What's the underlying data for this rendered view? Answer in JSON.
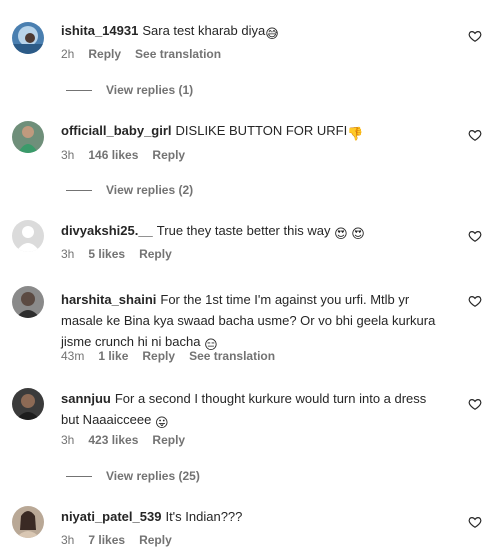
{
  "comments": [
    {
      "username": "ishita_14931",
      "text": "Sara test kharab diya",
      "emoji": "😅",
      "time": "2h",
      "likes": "",
      "reply": "Reply",
      "translation": "See translation",
      "view_replies": "View replies (1)"
    },
    {
      "username": "officiall_baby_girl",
      "text": "DISLIKE BUTTON FOR URFI",
      "emoji": "👎",
      "time": "3h",
      "likes": "146 likes",
      "reply": "Reply",
      "translation": "",
      "view_replies": "View replies (2)"
    },
    {
      "username": "divyakshi25.__",
      "text": "True they taste better this way",
      "emoji": "😍 😍",
      "time": "3h",
      "likes": "5 likes",
      "reply": "Reply",
      "translation": "",
      "view_replies": ""
    },
    {
      "username": "harshita_shaini",
      "text": "For the 1st time I'm against you urfi. Mtlb yr masale ke Bina kya swaad bacha usme? Or vo bhi geela kurkura jisme crunch hi ni bacha",
      "emoji": "😑",
      "time": "43m",
      "likes": "1 like",
      "reply": "Reply",
      "translation": "See translation",
      "view_replies": ""
    },
    {
      "username": "sannjuu",
      "text": "For a second I thought kurkure would turn into a dress but Naaaicceee",
      "emoji": "😛",
      "time": "3h",
      "likes": "423 likes",
      "reply": "Reply",
      "translation": "",
      "view_replies": "View replies (25)"
    },
    {
      "username": "niyati_patel_539",
      "text": "It's Indian???",
      "emoji": "",
      "time": "3h",
      "likes": "7 likes",
      "reply": "Reply",
      "translation": "",
      "view_replies": ""
    }
  ],
  "icons": {
    "like": "heart-outline-icon"
  },
  "colors": {
    "text": "#262626",
    "secondary": "#737373"
  }
}
